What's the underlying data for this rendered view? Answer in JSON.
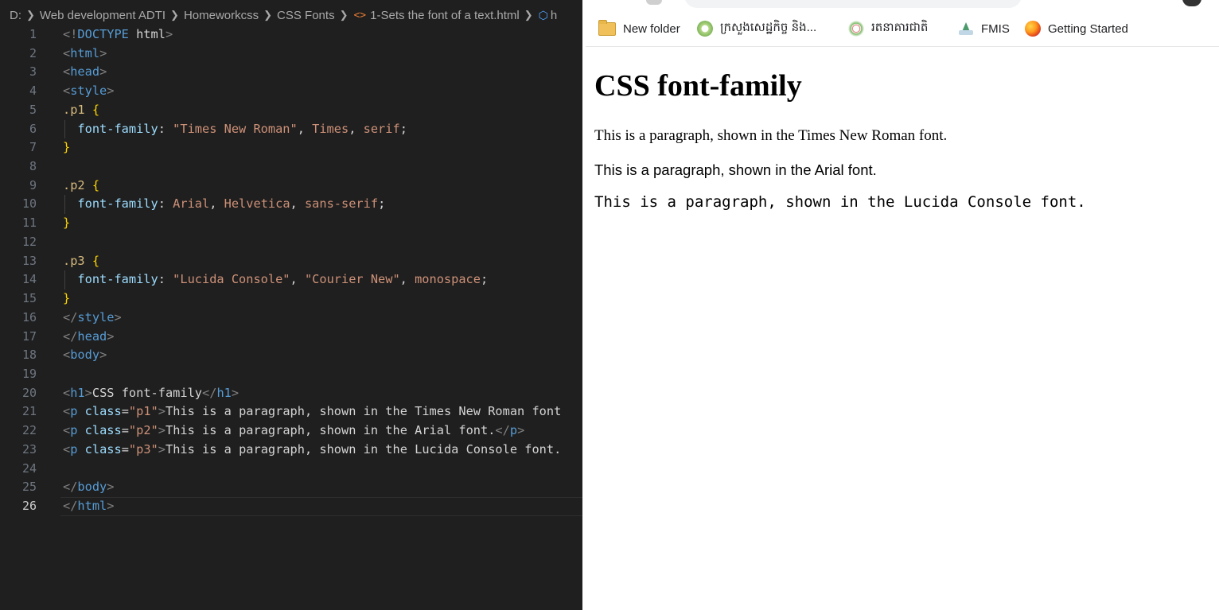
{
  "editor": {
    "breadcrumb": [
      "D:",
      "Web development ADTI",
      "Homeworkcss",
      "CSS Fonts",
      "1-Sets the font of a text.html"
    ],
    "breadcrumb_tail": "h",
    "lines": [
      {
        "n": "1"
      },
      {
        "n": "2"
      },
      {
        "n": "3"
      },
      {
        "n": "4"
      },
      {
        "n": "5"
      },
      {
        "n": "6"
      },
      {
        "n": "7"
      },
      {
        "n": "8"
      },
      {
        "n": "9"
      },
      {
        "n": "10"
      },
      {
        "n": "11"
      },
      {
        "n": "12"
      },
      {
        "n": "13"
      },
      {
        "n": "14"
      },
      {
        "n": "15"
      },
      {
        "n": "16"
      },
      {
        "n": "17"
      },
      {
        "n": "18"
      },
      {
        "n": "19"
      },
      {
        "n": "20"
      },
      {
        "n": "21"
      },
      {
        "n": "22"
      },
      {
        "n": "23"
      },
      {
        "n": "24"
      },
      {
        "n": "25"
      },
      {
        "n": "26"
      }
    ],
    "code": {
      "l1": {
        "a": "<!",
        "b": "DOCTYPE",
        "c": " html",
        "d": ">"
      },
      "l2": {
        "a": "<",
        "b": "html",
        "c": ">"
      },
      "l3": {
        "a": "<",
        "b": "head",
        "c": ">"
      },
      "l4": {
        "a": "<",
        "b": "style",
        "c": ">"
      },
      "l5": {
        "sel": ".p1",
        "br": " {"
      },
      "l6": {
        "prop": "font-family",
        "colon": ": ",
        "s1": "\"Times New Roman\"",
        "c1": ", ",
        "s2": "Times",
        "c2": ", ",
        "s3": "serif",
        "end": ";"
      },
      "l7": {
        "br": "}"
      },
      "l9": {
        "sel": ".p2",
        "br": " {"
      },
      "l10": {
        "prop": "font-family",
        "colon": ": ",
        "s1": "Arial",
        "c1": ", ",
        "s2": "Helvetica",
        "c2": ", ",
        "s3": "sans-serif",
        "end": ";"
      },
      "l11": {
        "br": "}"
      },
      "l13": {
        "sel": ".p3",
        "br": " {"
      },
      "l14": {
        "prop": "font-family",
        "colon": ": ",
        "s1": "\"Lucida Console\"",
        "c1": ", ",
        "s2": "\"Courier New\"",
        "c2": ", ",
        "s3": "monospace",
        "end": ";"
      },
      "l15": {
        "br": "}"
      },
      "l16": {
        "a": "</",
        "b": "style",
        "c": ">"
      },
      "l17": {
        "a": "</",
        "b": "head",
        "c": ">"
      },
      "l18": {
        "a": "<",
        "b": "body",
        "c": ">"
      },
      "l20": {
        "a": "<",
        "b": "h1",
        "c": ">",
        "t": "CSS font-family",
        "d": "</",
        "e": "h1",
        "f": ">"
      },
      "l21": {
        "a": "<",
        "b": "p",
        "at": " class",
        "eq": "=",
        "v": "\"p1\"",
        "c": ">",
        "t": "This is a paragraph, shown in the Times New Roman font"
      },
      "l22": {
        "a": "<",
        "b": "p",
        "at": " class",
        "eq": "=",
        "v": "\"p2\"",
        "c": ">",
        "t": "This is a paragraph, shown in the Arial font.",
        "d": "</",
        "e": "p",
        "f": ">"
      },
      "l23": {
        "a": "<",
        "b": "p",
        "at": " class",
        "eq": "=",
        "v": "\"p3\"",
        "c": ">",
        "t": "This is a paragraph, shown in the Lucida Console font."
      },
      "l25": {
        "a": "</",
        "b": "body",
        "c": ">"
      },
      "l26": {
        "a": "</",
        "b": "html",
        "c": ">"
      }
    }
  },
  "browser": {
    "bookmarks": [
      {
        "label": "New folder",
        "icon": "folder-icon"
      },
      {
        "label": "ក្រសួងសេដ្ឋកិច្ច និង...",
        "icon": "ministry-seal-icon"
      },
      {
        "label": "រតនាគារជាតិ",
        "icon": "treasury-seal-icon"
      },
      {
        "label": "FMIS",
        "icon": "fmis-icon"
      },
      {
        "label": "Getting Started",
        "icon": "firefox-icon"
      }
    ],
    "page": {
      "heading": "CSS font-family",
      "p1": "This is a paragraph, shown in the Times New Roman font.",
      "p2": "This is a paragraph, shown in the Arial font.",
      "p3": "This is a paragraph, shown in the Lucida Console font."
    }
  }
}
